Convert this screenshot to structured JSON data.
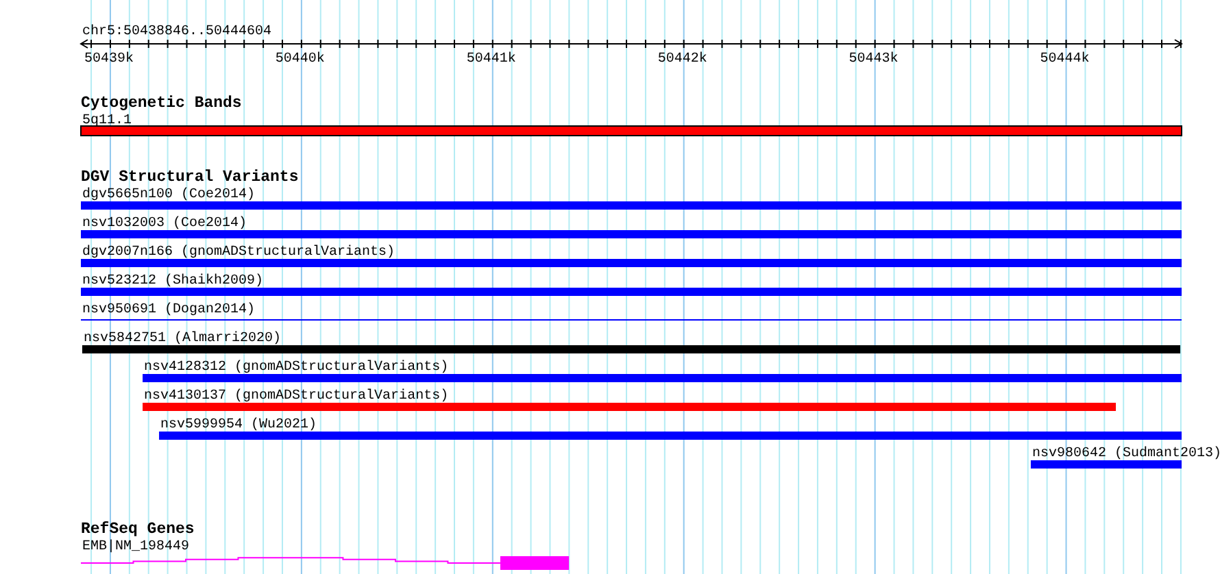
{
  "ruler": {
    "location": "chr5:50438846..50444604",
    "tick_labels": [
      "50439k",
      "50440k",
      "50441k",
      "50442k",
      "50443k",
      "50444k"
    ]
  },
  "tracks": [
    {
      "title": "Cytogenetic Bands",
      "features": [
        {
          "label": "5q11.1",
          "kind": "band",
          "color": "#ff0000"
        }
      ]
    },
    {
      "title": "DGV Structural Variants",
      "features": [
        {
          "label": "dgv5665n100 (Coe2014)",
          "kind": "bar",
          "color": "#0000ff"
        },
        {
          "label": "nsv1032003 (Coe2014)",
          "kind": "bar",
          "color": "#0000ff"
        },
        {
          "label": "dgv2007n166 (gnomADStructuralVariants)",
          "kind": "bar",
          "color": "#0000ff"
        },
        {
          "label": "nsv523212 (Shaikh2009)",
          "kind": "bar",
          "color": "#0000ff"
        },
        {
          "label": "nsv950691 (Dogan2014)",
          "kind": "line",
          "color": "#0000ff"
        },
        {
          "label": "nsv5842751 (Almarri2020)",
          "kind": "bar",
          "color": "#000000"
        },
        {
          "label": "nsv4128312 (gnomADStructuralVariants)",
          "kind": "bar",
          "color": "#0000ff"
        },
        {
          "label": "nsv4130137 (gnomADStructuralVariants)",
          "kind": "bar",
          "color": "#ff0000"
        },
        {
          "label": "nsv5999954 (Wu2021)",
          "kind": "bar",
          "color": "#0000ff"
        },
        {
          "label": "nsv980642 (Sudmant2013)",
          "kind": "bar",
          "color": "#0000ff"
        }
      ]
    },
    {
      "title": "RefSeq Genes",
      "features": [
        {
          "label": "EMB|NM_198449",
          "kind": "gene",
          "color": "#ff00ff"
        }
      ]
    }
  ]
}
